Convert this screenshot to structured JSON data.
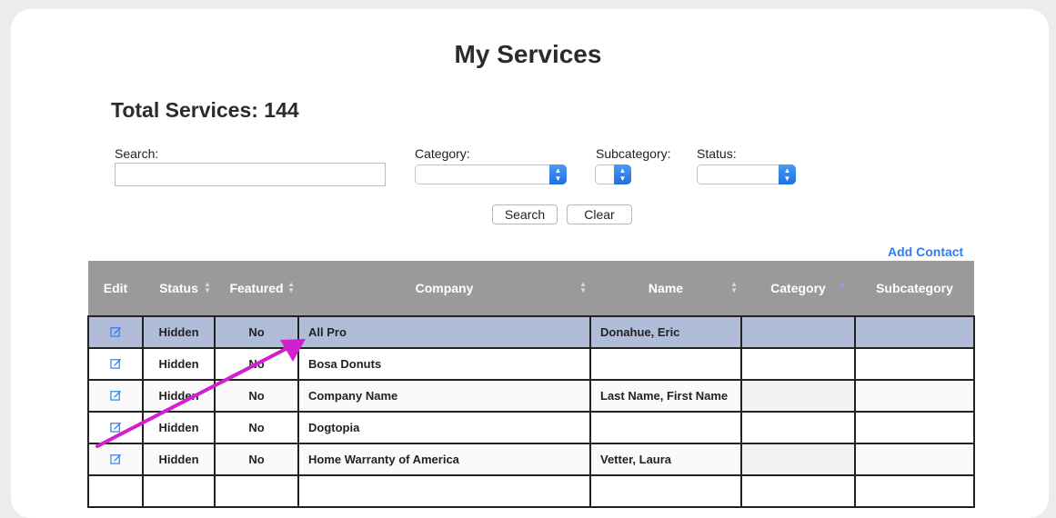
{
  "page_title": "My Services",
  "total_label": "Total Services: 144",
  "filters": {
    "search_label": "Search:",
    "search_value": "",
    "category_label": "Category:",
    "subcategory_label": "Subcategory:",
    "status_label": "Status:"
  },
  "buttons": {
    "search": "Search",
    "clear": "Clear"
  },
  "add_contact": "Add Contact",
  "table": {
    "headers": [
      "Edit",
      "Status",
      "Featured",
      "Company",
      "Name",
      "Category",
      "Subcategory"
    ],
    "rows": [
      {
        "status": "Hidden",
        "featured": "No",
        "company": "All Pro",
        "name": "Donahue, Eric",
        "category": "",
        "subcategory": ""
      },
      {
        "status": "Hidden",
        "featured": "No",
        "company": "Bosa Donuts",
        "name": "",
        "category": "",
        "subcategory": ""
      },
      {
        "status": "Hidden",
        "featured": "No",
        "company": "Company Name",
        "name": "Last Name, First Name",
        "category": "",
        "subcategory": ""
      },
      {
        "status": "Hidden",
        "featured": "No",
        "company": "Dogtopia",
        "name": "",
        "category": "",
        "subcategory": ""
      },
      {
        "status": "Hidden",
        "featured": "No",
        "company": "Home Warranty of America",
        "name": "Vetter, Laura",
        "category": "",
        "subcategory": ""
      }
    ]
  },
  "colors": {
    "header_bg": "#9a9a9a",
    "selected_row": "#b0bcd8",
    "link": "#2d7ff0",
    "annotation_arrow": "#d21fcf"
  },
  "icons": {
    "edit": "edit-pencil-icon",
    "sort": "sort-arrows-icon",
    "annotation": "pointer-arrow-annotation"
  }
}
